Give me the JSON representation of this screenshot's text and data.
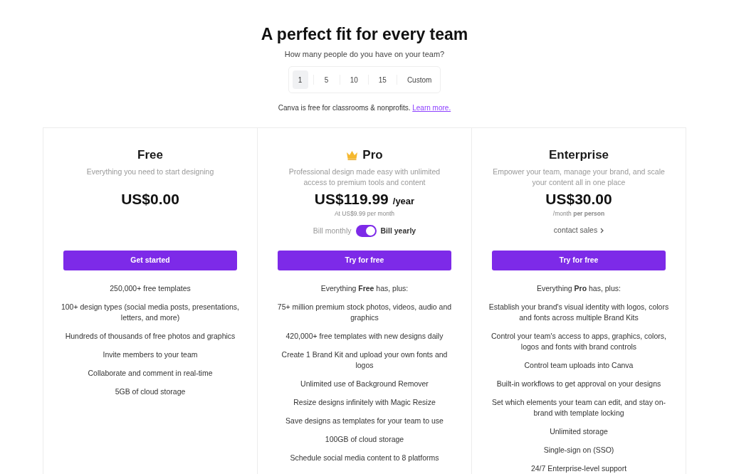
{
  "title": "A perfect fit for every team",
  "subtitle": "How many people do you have on your team?",
  "team_sizes": [
    {
      "label": "1",
      "selected": true
    },
    {
      "label": "5",
      "selected": false
    },
    {
      "label": "10",
      "selected": false
    },
    {
      "label": "15",
      "selected": false
    },
    {
      "label": "Custom",
      "selected": false
    }
  ],
  "note": {
    "text": "Canva is free for classrooms & nonprofits.",
    "link": "Learn more."
  },
  "plans": [
    {
      "name": "Free",
      "crown": false,
      "description": "Everything you need to start designing",
      "price": "US$0.00",
      "button": "Get started",
      "features": [
        "250,000+ free templates",
        "100+ design types (social media posts, presentations, letters, and more)",
        "Hundreds of thousands of free photos and graphics",
        "Invite members to your team",
        "Collaborate and comment in real-time",
        "5GB of cloud storage"
      ]
    },
    {
      "name": "Pro",
      "crown": true,
      "description": "Professional design made easy with unlimited access to premium tools and content",
      "price": "US$119.99",
      "price_suffix": "/year",
      "price_note": "At US$9.99 per month",
      "billing": {
        "left_label": "Bill monthly",
        "right_label": "Bill yearly",
        "on": true
      },
      "button": "Try for free",
      "features": [
        "Everything **Free** has, plus:",
        "75+ million premium stock photos, videos, audio and graphics",
        "420,000+ free templates with new designs daily",
        "Create 1 Brand Kit and upload your own fonts and logos",
        "Unlimited use of Background Remover",
        "Resize designs infinitely with Magic Resize",
        "Save designs as templates for your team to use",
        "100GB of cloud storage",
        "Schedule social media content to 8 platforms"
      ]
    },
    {
      "name": "Enterprise",
      "crown": false,
      "description": "Empower your team, manage your brand, and scale your content all in one place",
      "price": "US$30.00",
      "price_note": "/month **per person**",
      "contact_link": "contact sales",
      "button": "Try for free",
      "features": [
        "Everything **Pro** has, plus:",
        "Establish your brand's visual identity with logos, colors and fonts across multiple Brand Kits",
        "Control your team's access to apps, graphics, colors, logos and fonts with brand controls",
        "Control team uploads into Canva",
        "Built-in workflows to get approval on your designs",
        "Set which elements your team can edit, and stay on-brand with template locking",
        "Unlimited storage",
        "Single-sign on (SSO)",
        "24/7 Enterprise-level support"
      ]
    }
  ]
}
